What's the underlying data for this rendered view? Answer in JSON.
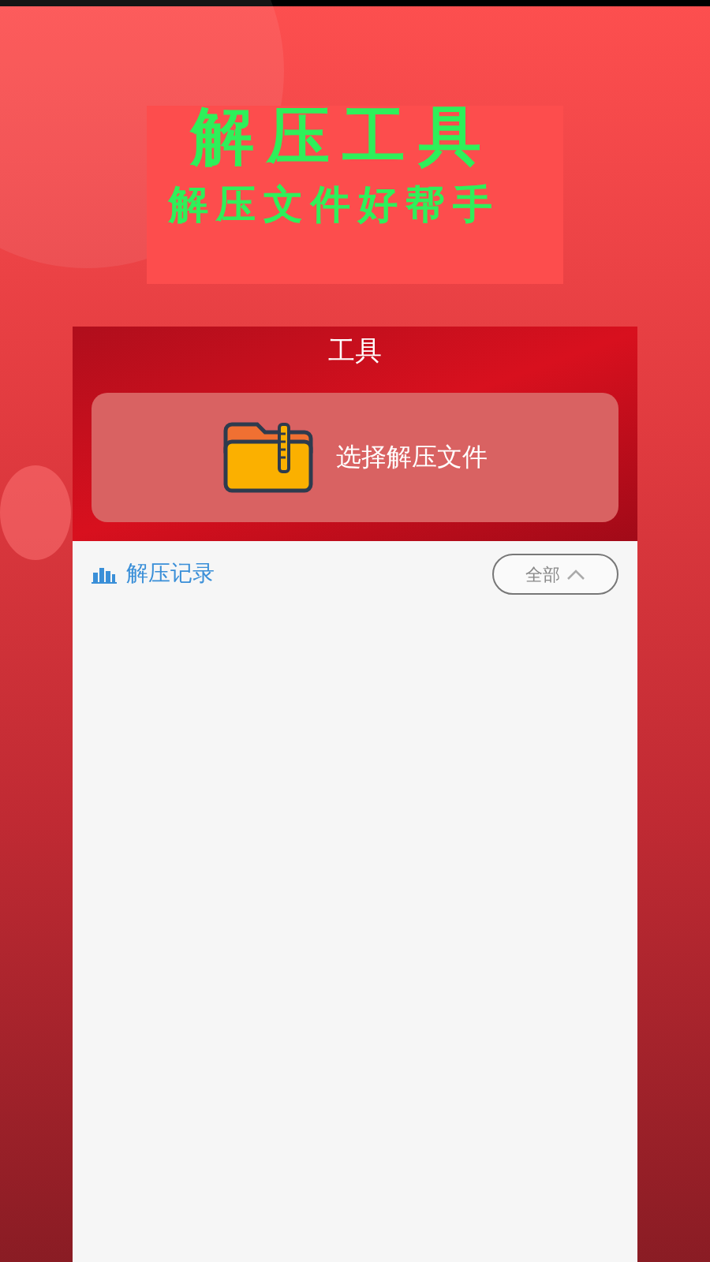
{
  "banner": {
    "title": "解压工具",
    "subtitle": "解压文件好帮手"
  },
  "tool_card": {
    "title": "工具",
    "select_button": {
      "label": "选择解压文件"
    }
  },
  "history": {
    "title": "解压记录",
    "filter": {
      "label": "全部",
      "expanded": true
    }
  }
}
